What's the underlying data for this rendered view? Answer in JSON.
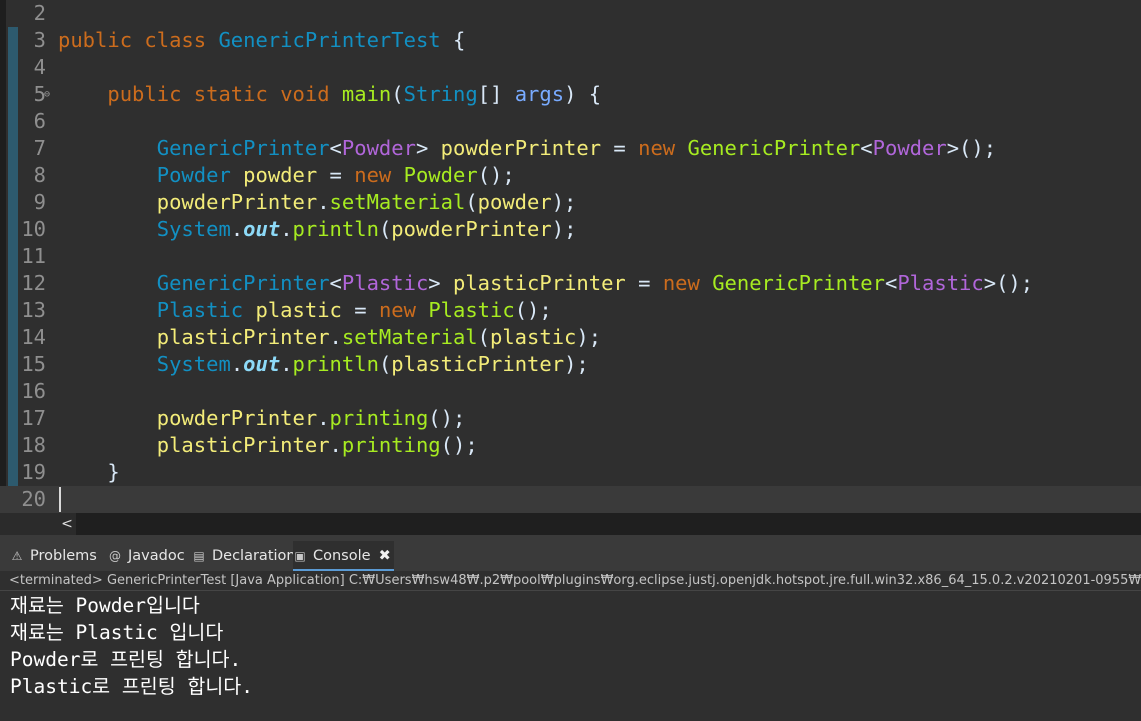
{
  "editor": {
    "lines": [
      {
        "no": "2",
        "tokens": []
      },
      {
        "no": "3",
        "tokens": [
          {
            "t": "public",
            "c": "kw"
          },
          {
            "t": " ",
            "c": "txt"
          },
          {
            "t": "class",
            "c": "kw"
          },
          {
            "t": " ",
            "c": "txt"
          },
          {
            "t": "GenericPrinterTest",
            "c": "cls"
          },
          {
            "t": " {",
            "c": "txt"
          }
        ]
      },
      {
        "no": "4",
        "tokens": []
      },
      {
        "no": "5",
        "fold": "⊖",
        "tokens": [
          {
            "t": "    ",
            "c": "txt"
          },
          {
            "t": "public",
            "c": "kw"
          },
          {
            "t": " ",
            "c": "txt"
          },
          {
            "t": "static",
            "c": "kw"
          },
          {
            "t": " ",
            "c": "txt"
          },
          {
            "t": "void",
            "c": "kw"
          },
          {
            "t": " ",
            "c": "txt"
          },
          {
            "t": "main",
            "c": "mth"
          },
          {
            "t": "(",
            "c": "txt"
          },
          {
            "t": "String",
            "c": "cls"
          },
          {
            "t": "[] ",
            "c": "txt"
          },
          {
            "t": "args",
            "c": "prm"
          },
          {
            "t": ") {",
            "c": "txt"
          }
        ]
      },
      {
        "no": "6",
        "tokens": []
      },
      {
        "no": "7",
        "tokens": [
          {
            "t": "        ",
            "c": "txt"
          },
          {
            "t": "GenericPrinter",
            "c": "cls"
          },
          {
            "t": "<",
            "c": "txt"
          },
          {
            "t": "Powder",
            "c": "typ"
          },
          {
            "t": "> ",
            "c": "txt"
          },
          {
            "t": "powderPrinter",
            "c": "var"
          },
          {
            "t": " = ",
            "c": "txt"
          },
          {
            "t": "new",
            "c": "kw"
          },
          {
            "t": " ",
            "c": "txt"
          },
          {
            "t": "GenericPrinter",
            "c": "mth"
          },
          {
            "t": "<",
            "c": "txt"
          },
          {
            "t": "Powder",
            "c": "typ"
          },
          {
            "t": ">();",
            "c": "txt"
          }
        ]
      },
      {
        "no": "8",
        "tokens": [
          {
            "t": "        ",
            "c": "txt"
          },
          {
            "t": "Powder",
            "c": "cls"
          },
          {
            "t": " ",
            "c": "txt"
          },
          {
            "t": "powder",
            "c": "var"
          },
          {
            "t": " = ",
            "c": "txt"
          },
          {
            "t": "new",
            "c": "kw"
          },
          {
            "t": " ",
            "c": "txt"
          },
          {
            "t": "Powder",
            "c": "mth"
          },
          {
            "t": "();",
            "c": "txt"
          }
        ]
      },
      {
        "no": "9",
        "tokens": [
          {
            "t": "        ",
            "c": "txt"
          },
          {
            "t": "powderPrinter",
            "c": "var"
          },
          {
            "t": ".",
            "c": "txt"
          },
          {
            "t": "setMaterial",
            "c": "mth"
          },
          {
            "t": "(",
            "c": "txt"
          },
          {
            "t": "powder",
            "c": "var"
          },
          {
            "t": ");",
            "c": "txt"
          }
        ]
      },
      {
        "no": "10",
        "tokens": [
          {
            "t": "        ",
            "c": "txt"
          },
          {
            "t": "System",
            "c": "cls"
          },
          {
            "t": ".",
            "c": "txt"
          },
          {
            "t": "out",
            "c": "out"
          },
          {
            "t": ".",
            "c": "txt"
          },
          {
            "t": "println",
            "c": "mth"
          },
          {
            "t": "(",
            "c": "txt"
          },
          {
            "t": "powderPrinter",
            "c": "var"
          },
          {
            "t": ");",
            "c": "txt"
          }
        ]
      },
      {
        "no": "11",
        "tokens": []
      },
      {
        "no": "12",
        "tokens": [
          {
            "t": "        ",
            "c": "txt"
          },
          {
            "t": "GenericPrinter",
            "c": "cls"
          },
          {
            "t": "<",
            "c": "txt"
          },
          {
            "t": "Plastic",
            "c": "typ"
          },
          {
            "t": "> ",
            "c": "txt"
          },
          {
            "t": "plasticPrinter",
            "c": "var"
          },
          {
            "t": " = ",
            "c": "txt"
          },
          {
            "t": "new",
            "c": "kw"
          },
          {
            "t": " ",
            "c": "txt"
          },
          {
            "t": "GenericPrinter",
            "c": "mth"
          },
          {
            "t": "<",
            "c": "txt"
          },
          {
            "t": "Plastic",
            "c": "typ"
          },
          {
            "t": ">();",
            "c": "txt"
          }
        ]
      },
      {
        "no": "13",
        "tokens": [
          {
            "t": "        ",
            "c": "txt"
          },
          {
            "t": "Plastic",
            "c": "cls"
          },
          {
            "t": " ",
            "c": "txt"
          },
          {
            "t": "plastic",
            "c": "var"
          },
          {
            "t": " = ",
            "c": "txt"
          },
          {
            "t": "new",
            "c": "kw"
          },
          {
            "t": " ",
            "c": "txt"
          },
          {
            "t": "Plastic",
            "c": "mth"
          },
          {
            "t": "();",
            "c": "txt"
          }
        ]
      },
      {
        "no": "14",
        "tokens": [
          {
            "t": "        ",
            "c": "txt"
          },
          {
            "t": "plasticPrinter",
            "c": "var"
          },
          {
            "t": ".",
            "c": "txt"
          },
          {
            "t": "setMaterial",
            "c": "mth"
          },
          {
            "t": "(",
            "c": "txt"
          },
          {
            "t": "plastic",
            "c": "var"
          },
          {
            "t": ");",
            "c": "txt"
          }
        ]
      },
      {
        "no": "15",
        "tokens": [
          {
            "t": "        ",
            "c": "txt"
          },
          {
            "t": "System",
            "c": "cls"
          },
          {
            "t": ".",
            "c": "txt"
          },
          {
            "t": "out",
            "c": "out"
          },
          {
            "t": ".",
            "c": "txt"
          },
          {
            "t": "println",
            "c": "mth"
          },
          {
            "t": "(",
            "c": "txt"
          },
          {
            "t": "plasticPrinter",
            "c": "var"
          },
          {
            "t": ");",
            "c": "txt"
          }
        ]
      },
      {
        "no": "16",
        "tokens": []
      },
      {
        "no": "17",
        "tokens": [
          {
            "t": "        ",
            "c": "txt"
          },
          {
            "t": "powderPrinter",
            "c": "var"
          },
          {
            "t": ".",
            "c": "txt"
          },
          {
            "t": "printing",
            "c": "mth"
          },
          {
            "t": "();",
            "c": "txt"
          }
        ]
      },
      {
        "no": "18",
        "tokens": [
          {
            "t": "        ",
            "c": "txt"
          },
          {
            "t": "plasticPrinter",
            "c": "var"
          },
          {
            "t": ".",
            "c": "txt"
          },
          {
            "t": "printing",
            "c": "mth"
          },
          {
            "t": "();",
            "c": "txt"
          }
        ]
      },
      {
        "no": "19",
        "tokens": [
          {
            "t": "    ",
            "c": "txt"
          },
          {
            "t": "}",
            "c": "txt"
          }
        ]
      },
      {
        "no": "20",
        "current": true,
        "tokens": []
      }
    ],
    "hscroll_arrow": "<"
  },
  "tabs": [
    {
      "label": "Problems",
      "icon": "problems-icon",
      "glyph": "⚠",
      "active": false
    },
    {
      "label": "Javadoc",
      "icon": "javadoc-icon",
      "glyph": "@",
      "active": false
    },
    {
      "label": "Declaration",
      "icon": "declaration-icon",
      "glyph": "▤",
      "active": false
    },
    {
      "label": "Console",
      "icon": "console-icon",
      "glyph": "▣",
      "active": true,
      "close": "✖"
    }
  ],
  "console": {
    "status": "<terminated> GenericPrinterTest [Java Application] C:₩Users₩hsw48₩.p2₩pool₩plugins₩org.eclipse.justj.openjdk.hotspot.jre.full.win32.x86_64_15.0.2.v20210201-0955₩",
    "output": [
      "재료는 Powder입니다",
      "재료는 Plastic 입니다",
      "Powder로 프린팅 합니다.",
      "Plastic로 프린팅 합니다."
    ]
  },
  "colors": {
    "background": "#2f2f2f",
    "keyword": "#cc6c1d",
    "class": "#1290c3",
    "type_param": "#b166da",
    "variable": "#f3ec79",
    "method": "#a7ec21",
    "param": "#79abff",
    "static_field": "#8ddaf8"
  }
}
